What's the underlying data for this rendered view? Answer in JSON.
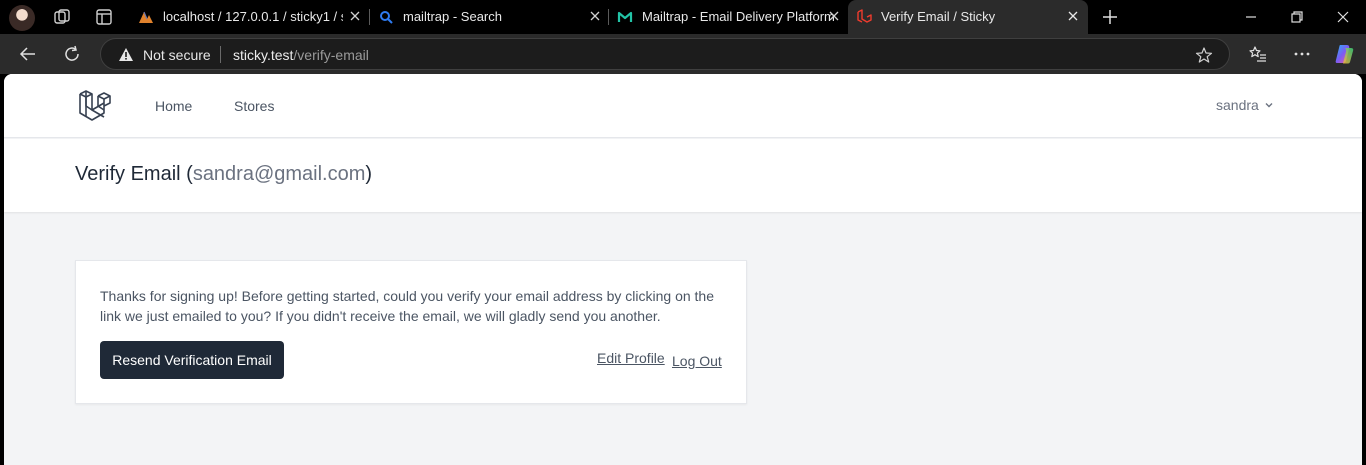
{
  "browser": {
    "tabs": [
      {
        "title": "localhost / 127.0.0.1 / sticky1 / sto",
        "icon": "phpmyadmin-icon"
      },
      {
        "title": "mailtrap - Search",
        "icon": "search-icon"
      },
      {
        "title": "Mailtrap - Email Delivery Platform",
        "icon": "mailtrap-icon"
      },
      {
        "title": "Verify Email / Sticky",
        "icon": "laravel-icon",
        "active": true
      }
    ],
    "security_label": "Not secure",
    "url_host": "sticky.test",
    "url_path": "/verify-email"
  },
  "nav": {
    "links": [
      "Home",
      "Stores"
    ],
    "user_name": "sandra"
  },
  "header": {
    "title_prefix": "Verify Email (",
    "email": "sandra@gmail.com",
    "title_suffix": ")"
  },
  "card": {
    "message": "Thanks for signing up! Before getting started, could you verify your email address by clicking on the link we just emailed to you? If you didn't receive the email, we will gladly send you another.",
    "resend_label": "Resend Verification Email",
    "edit_profile_label": "Edit Profile",
    "logout_label": "Log Out"
  },
  "colors": {
    "button_bg": "#1f2937",
    "page_bg": "#f3f4f6",
    "browser_chrome": "#2b2b2b",
    "laravel_red": "#ef3b2d"
  }
}
